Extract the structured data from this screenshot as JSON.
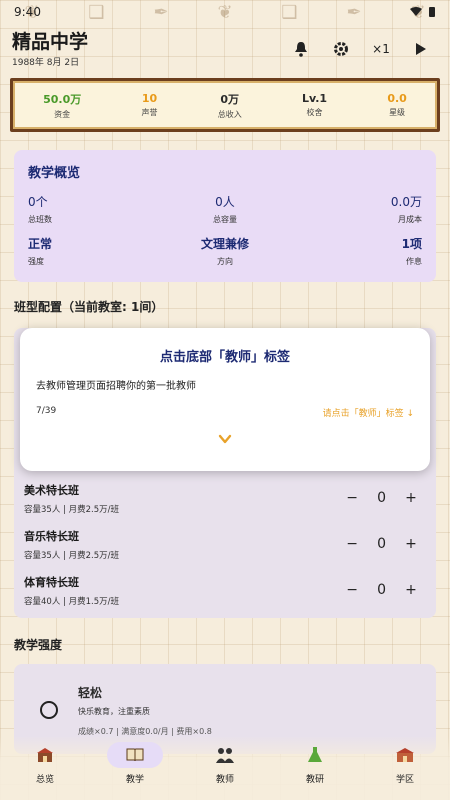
{
  "status_bar": {
    "time": "9:40"
  },
  "header": {
    "title": "精品中学",
    "date": "1988年 8月 2日",
    "speed": "×1"
  },
  "stats": [
    {
      "value": "50.0万",
      "label": "资金",
      "color": "#4a9a2a"
    },
    {
      "value": "10",
      "label": "声誉",
      "color": "#e89a1a"
    },
    {
      "value": "0万",
      "label": "总收入",
      "color": "#222222"
    },
    {
      "value": "Lv.1",
      "label": "校舍",
      "color": "#222222"
    },
    {
      "value": "0.0",
      "label": "星级",
      "color": "#e89a1a"
    }
  ],
  "overview": {
    "title": "教学概览",
    "cells": [
      {
        "value": "0个",
        "label": "总班数"
      },
      {
        "value": "0人",
        "label": "总容量"
      },
      {
        "value": "0.0万",
        "label": "月成本"
      },
      {
        "value": "正常",
        "label": "强度"
      },
      {
        "value": "文理兼修",
        "label": "方向"
      },
      {
        "value": "1项",
        "label": "作息"
      }
    ]
  },
  "class_section_title": "班型配置（当前教室: 1间）",
  "classes": [
    {
      "name": "美术特长班",
      "sub": "容量35人 | 月费2.5万/班",
      "count": "0"
    },
    {
      "name": "音乐特长班",
      "sub": "容量35人 | 月费2.5万/班",
      "count": "0"
    },
    {
      "name": "体育特长班",
      "sub": "容量40人 | 月费1.5万/班",
      "count": "0"
    }
  ],
  "stepper": {
    "minus": "−",
    "plus": "+"
  },
  "intensity_section_title": "教学强度",
  "intensity": {
    "name": "轻松",
    "desc": "快乐教育，注重素质",
    "meta": "成绩×0.7 | 满意度0.0/月 | 费用×0.8"
  },
  "tutorial": {
    "title": "点击底部「教师」标签",
    "message": "去教师管理页面招聘你的第一批教师",
    "step": "7/39",
    "hint": "请点击「教师」标签 ↓"
  },
  "nav": [
    {
      "label": "总览",
      "icon": "school-icon"
    },
    {
      "label": "教学",
      "icon": "book-icon",
      "active": true
    },
    {
      "label": "教师",
      "icon": "teacher-icon"
    },
    {
      "label": "教研",
      "icon": "flask-icon"
    },
    {
      "label": "学区",
      "icon": "district-icon"
    }
  ]
}
